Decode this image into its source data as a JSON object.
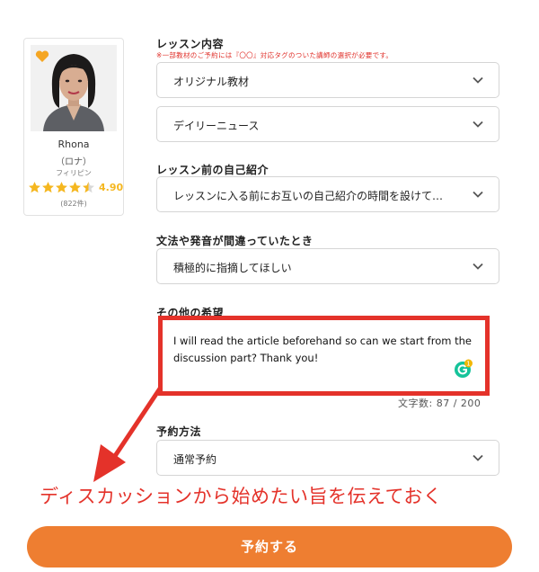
{
  "tutor": {
    "name": "Rhona",
    "kana": "（ロナ）",
    "country": "フィリピン",
    "rating": "4.90",
    "rating_stars": 4.5,
    "review_count": "(822件)",
    "favorite_icon": "heart-icon"
  },
  "form": {
    "lesson_content_label": "レッスン内容",
    "lesson_content_note": "※一部教材のご予約には『〇〇』対応タグのついた講師の選択が必要です。",
    "material_select": "オリジナル教材",
    "sub_material_select": "デイリーニュース",
    "intro_label": "レッスン前の自己紹介",
    "intro_select": "レッスンに入る前にお互いの自己紹介の時間を設けて…",
    "correction_label": "文法や発音が間違っていたとき",
    "correction_select": "積極的に指摘してほしい",
    "other_label": "その他の希望",
    "other_text": "I will read the article beforehand so can we start from the discussion part? Thank you!",
    "grammarly_badge": "1",
    "char_count": "文字数: 87 / 200",
    "booking_method_label": "予約方法",
    "booking_method_select": "通常予約",
    "submit_label": "予約する"
  },
  "annotation": {
    "text": "ディスカッションから始めたい旨を伝えておく",
    "color": "#e4322a"
  },
  "colors": {
    "accent": "#ee7e31",
    "star": "#f5b720",
    "note_red": "#e0302a"
  }
}
